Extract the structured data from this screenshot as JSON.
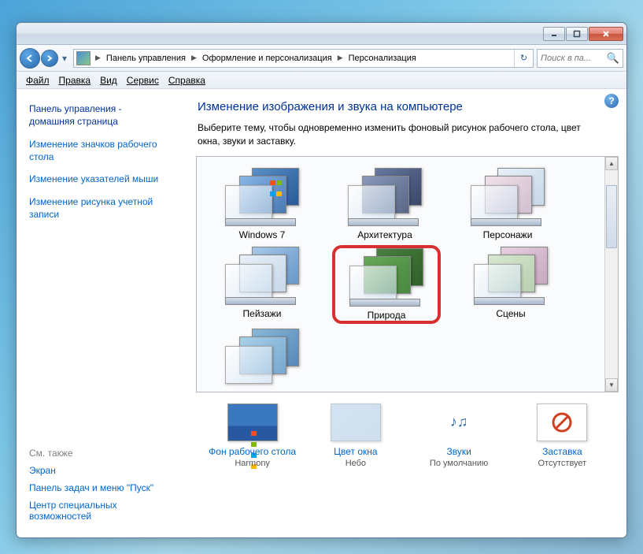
{
  "breadcrumbs": {
    "seg1": "Панель управления",
    "seg2": "Оформление и персонализация",
    "seg3": "Персонализация"
  },
  "search": {
    "placeholder": "Поиск в па..."
  },
  "menu": {
    "file": "Файл",
    "edit": "Правка",
    "view": "Вид",
    "tools": "Сервис",
    "help": "Справка"
  },
  "sidebar": {
    "head1": "Панель управления -",
    "head2": "домашняя страница",
    "link1": "Изменение значков рабочего стола",
    "link2": "Изменение указателей мыши",
    "link3": "Изменение рисунка учетной записи",
    "alsoHead": "См. также",
    "also1": "Экран",
    "also2": "Панель задач и меню \"Пуск\"",
    "also3": "Центр специальных возможностей"
  },
  "content": {
    "title": "Изменение изображения и звука на компьютере",
    "desc": "Выберите тему, чтобы одновременно изменить фоновый рисунок рабочего стола, цвет окна, звуки и заставку."
  },
  "themes": [
    {
      "label": "Windows 7"
    },
    {
      "label": "Архитектура"
    },
    {
      "label": "Персонажи"
    },
    {
      "label": "Пейзажи"
    },
    {
      "label": "Природа"
    },
    {
      "label": "Сцены"
    },
    {
      "label": ""
    }
  ],
  "bottom": [
    {
      "title": "Фон рабочего стола",
      "sub": "Harmony"
    },
    {
      "title": "Цвет окна",
      "sub": "Небо"
    },
    {
      "title": "Звуки",
      "sub": "По умолчанию"
    },
    {
      "title": "Заставка",
      "sub": "Отсутствует"
    }
  ]
}
